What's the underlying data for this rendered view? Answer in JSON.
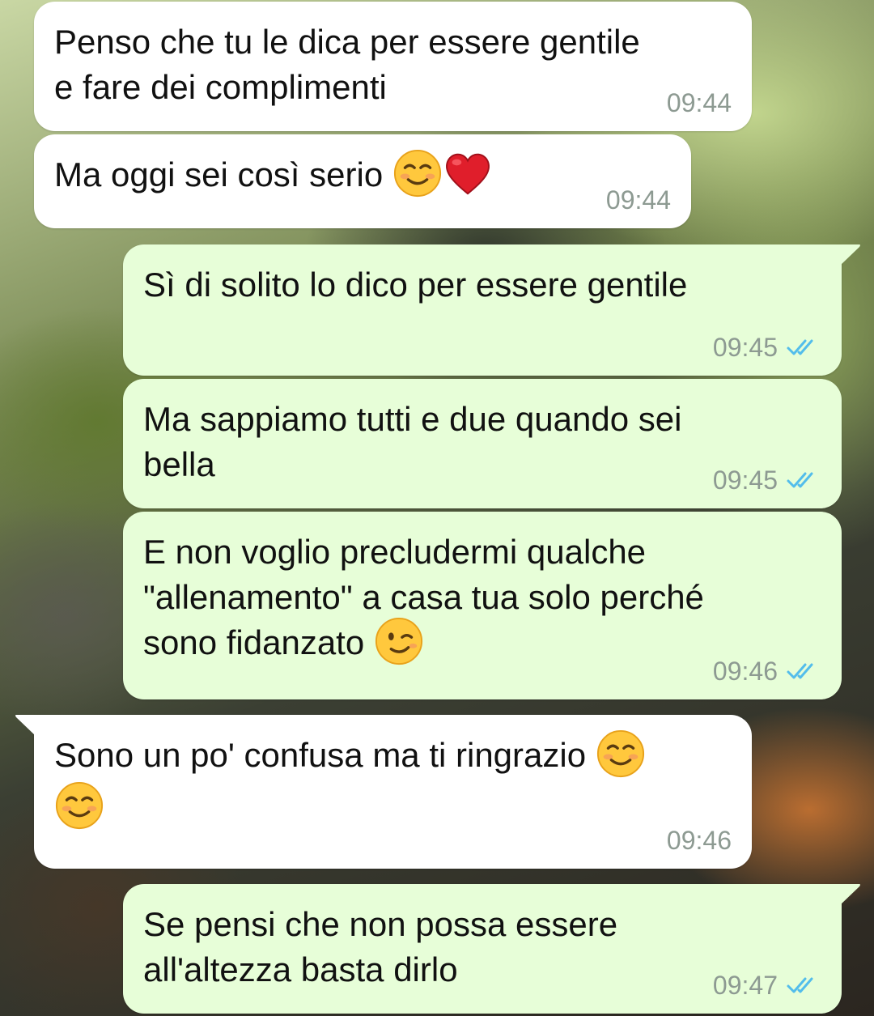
{
  "chat": {
    "messages": [
      {
        "direction": "in",
        "text": "Penso che tu le dica per essere gentile\ne fare dei complimenti",
        "time": "09:44"
      },
      {
        "direction": "in",
        "text": "Ma oggi sei così serio",
        "emojis": [
          "smiling-face",
          "red-heart"
        ],
        "time": "09:44"
      },
      {
        "direction": "out",
        "text": "Sì di solito lo dico per essere gentile",
        "time": "09:45",
        "status": "read"
      },
      {
        "direction": "out",
        "text": "Ma sappiamo tutti e due quando sei\nbella",
        "time": "09:45",
        "status": "read"
      },
      {
        "direction": "out",
        "text": "E non voglio precludermi qualche\n\"allenamento\" a casa tua solo perché\nsono fidanzato",
        "emojis": [
          "winking-face"
        ],
        "time": "09:46",
        "status": "read"
      },
      {
        "direction": "in",
        "text": "Sono un po' confusa ma ti ringrazio",
        "emojis": [
          "smiling-face",
          "smiling-face"
        ],
        "time": "09:46"
      },
      {
        "direction": "out",
        "text": "Se pensi che non possa essere\nall'altezza basta dirlo",
        "time": "09:47",
        "status": "read"
      }
    ]
  },
  "colors": {
    "incoming_bubble": "#ffffff",
    "outgoing_bubble": "#e7fed8",
    "timestamp": "#8d9a92",
    "read_ticks": "#53bdeb"
  }
}
